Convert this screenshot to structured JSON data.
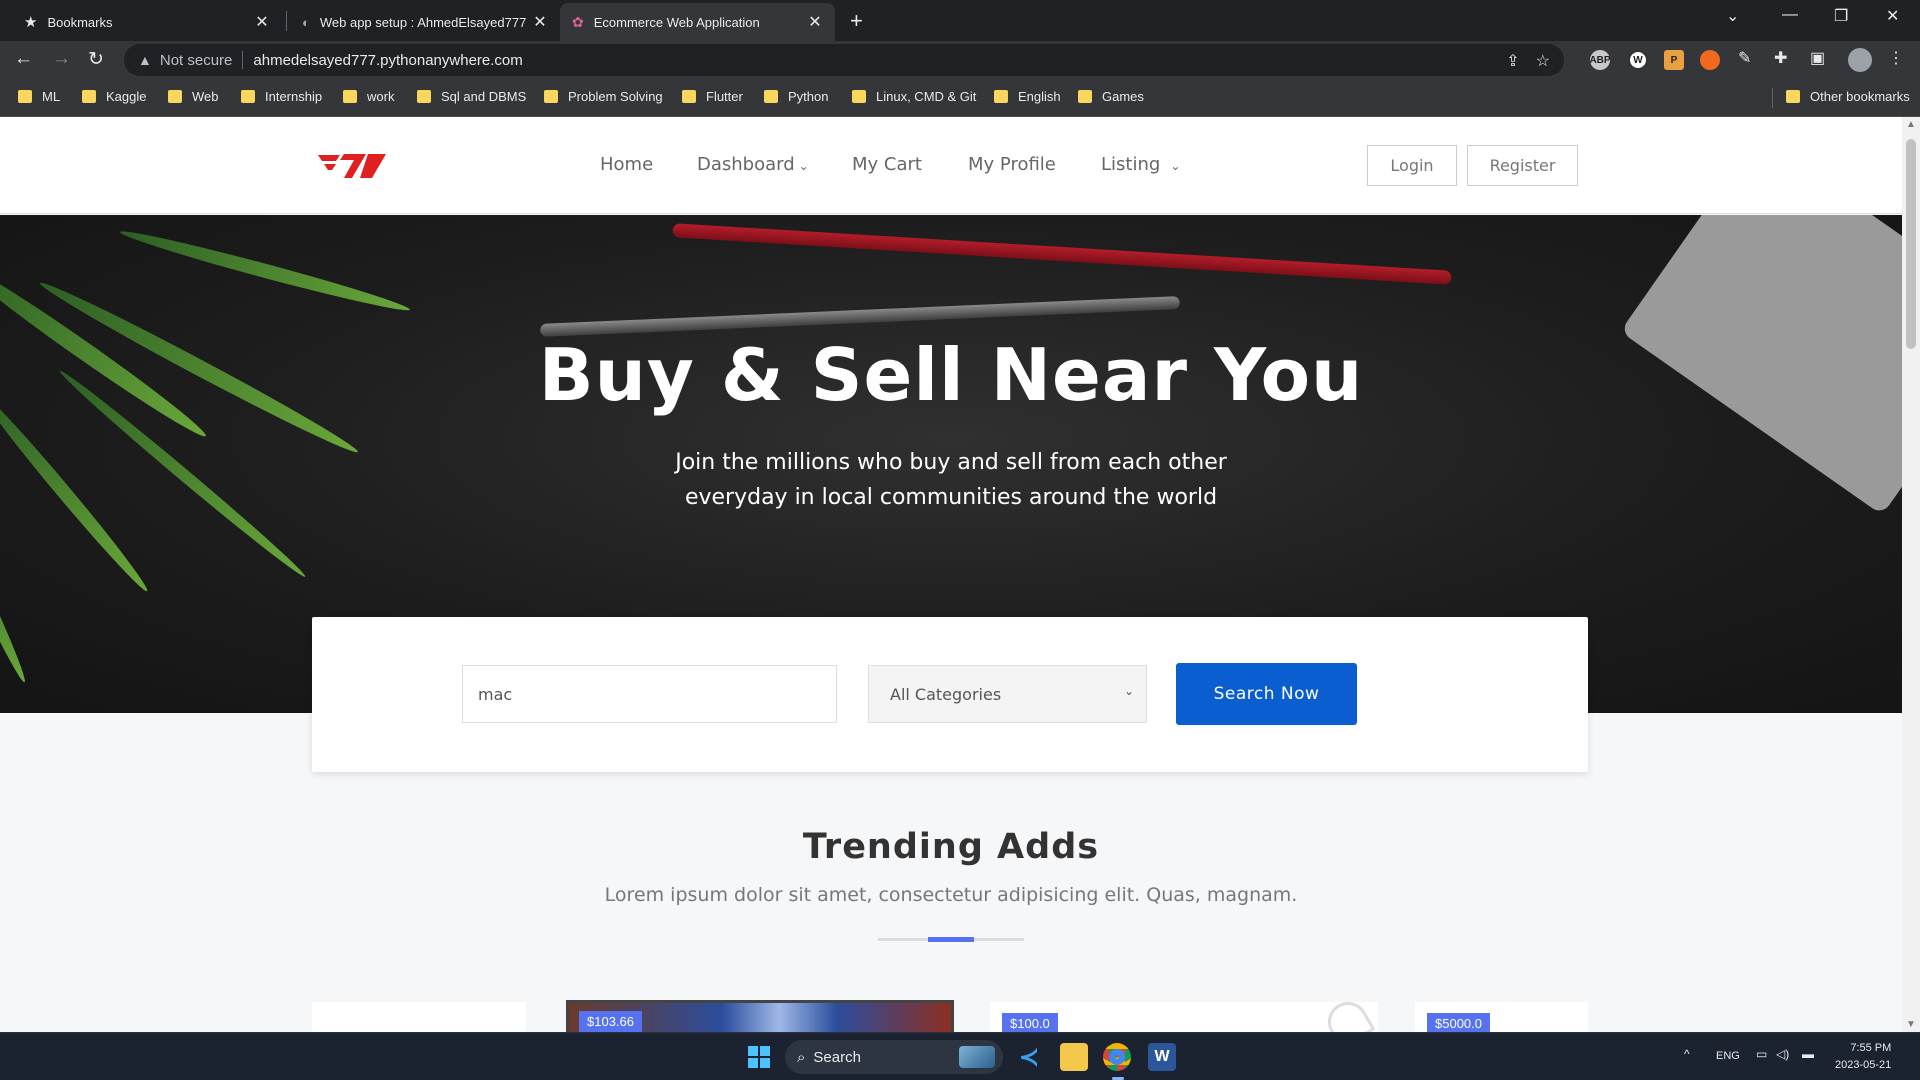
{
  "browser": {
    "tabs": [
      {
        "title": "Bookmarks",
        "icon": "star-icon"
      },
      {
        "title": "Web app setup : AhmedElsayed777",
        "icon": "pythonanywhere-icon"
      },
      {
        "title": "Ecommerce Web Application",
        "icon": "lotus-icon",
        "active": true
      }
    ],
    "security_label": "Not secure",
    "url": "ahmedelsayed777.pythonanywhere.com",
    "extensions": [
      "abp-icon",
      "w-icon",
      "p-icon",
      "fox-icon",
      "pen-icon",
      "puzzle-icon"
    ],
    "bookmarks": [
      "ML",
      "Kaggle",
      "Web",
      "Internship",
      "work",
      "Sql and DBMS",
      "Problem Solving",
      "Flutter",
      "Python",
      "Linux, CMD & Git",
      "English",
      "Games"
    ],
    "other_bookmarks": "Other bookmarks"
  },
  "site": {
    "nav": {
      "home": "Home",
      "dashboard": "Dashboard",
      "cart": "My Cart",
      "profile": "My Profile",
      "listing": "Listing",
      "login": "Login",
      "register": "Register"
    },
    "hero": {
      "title": "Buy & Sell Near You",
      "subtitle_line1": "Join the millions who buy and sell from each other",
      "subtitle_line2": "everyday in local communities around the world"
    },
    "search": {
      "value": "mac",
      "category": "All Categories",
      "button": "Search Now"
    },
    "trending": {
      "title": "Trending Adds",
      "subtitle": "Lorem ipsum dolor sit amet, consectetur adipisicing elit. Quas, magnam."
    },
    "cards": [
      {
        "price": ""
      },
      {
        "price": "$103.66"
      },
      {
        "price": "$100.0"
      },
      {
        "price": "$5000.0"
      }
    ],
    "colors": {
      "primary": "#0a5ecf",
      "accent": "#5672f0",
      "logo": "#e02020"
    }
  },
  "taskbar": {
    "search": "Search",
    "lang": "ENG",
    "time": "7:55 PM",
    "date": "2023-05-21"
  }
}
